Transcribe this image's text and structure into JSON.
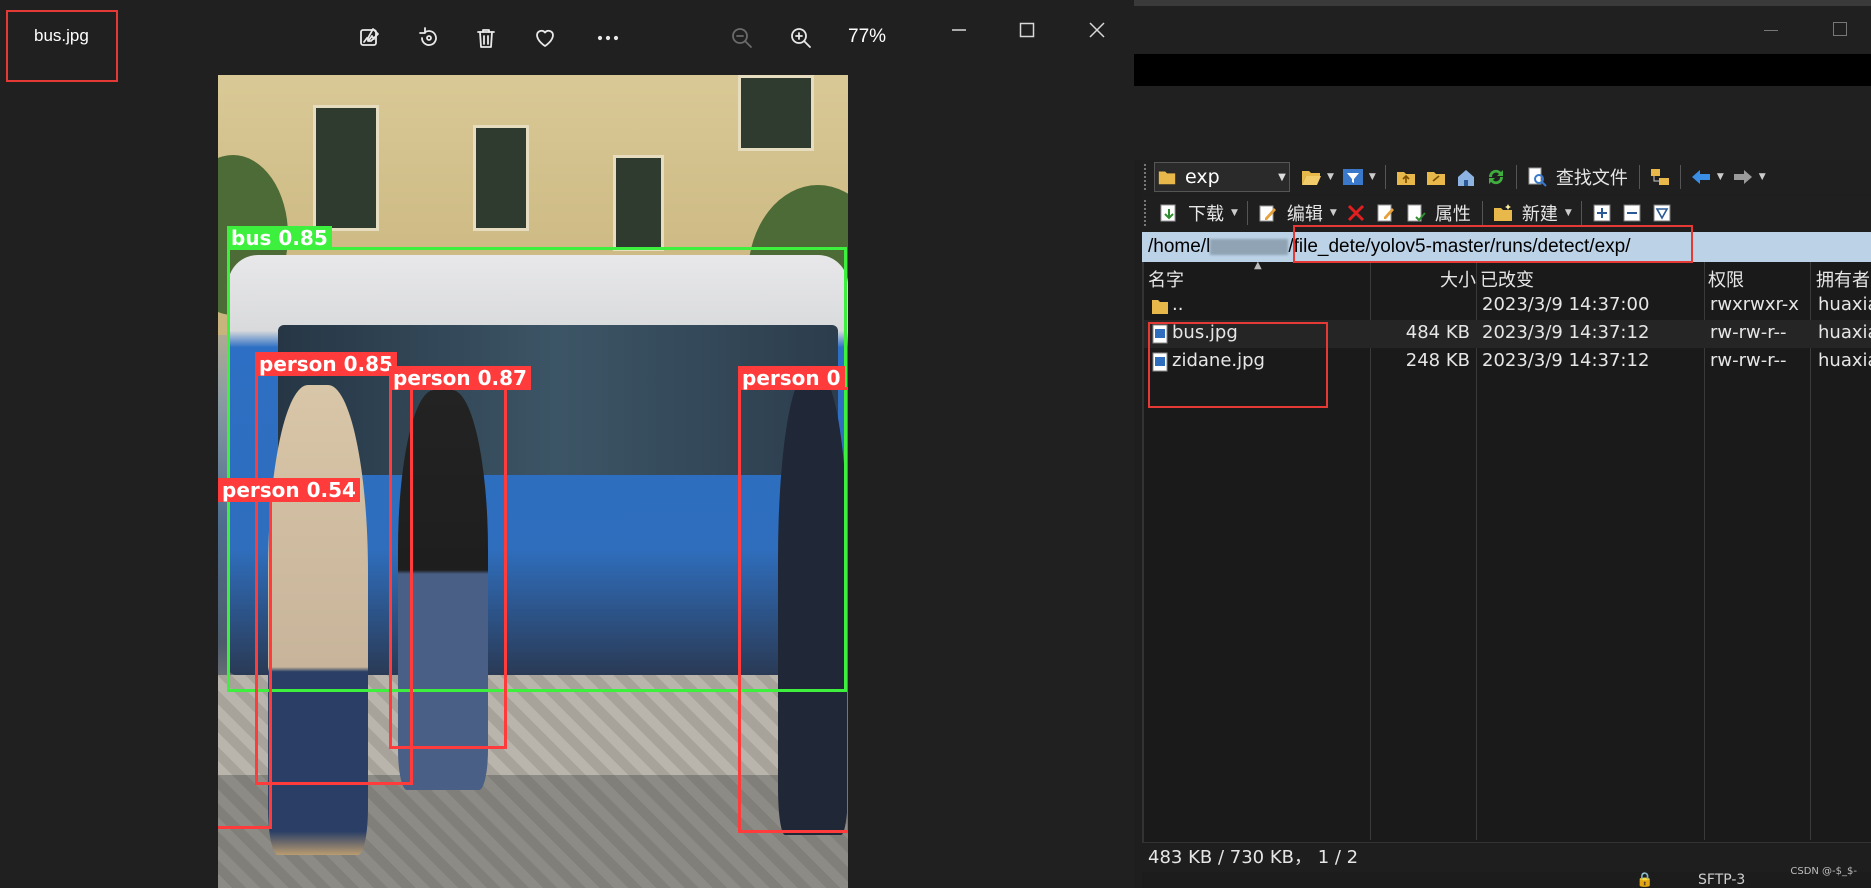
{
  "viewer": {
    "filename": "bus.jpg",
    "zoom": "77%",
    "toolbar": [
      "edit-image",
      "rotate",
      "delete",
      "favorite",
      "more",
      "zoom-out",
      "zoom-in"
    ],
    "detections": [
      {
        "label": "bus 0.85",
        "class": "bus"
      },
      {
        "label": "person 0.85",
        "class": "person"
      },
      {
        "label": "person 0.87",
        "class": "person"
      },
      {
        "label": "person 0",
        "class": "person"
      },
      {
        "label": "person 0.54",
        "class": "person"
      }
    ]
  },
  "fm": {
    "combo": "exp",
    "toolbar1": {
      "find_files": "查找文件"
    },
    "toolbar2": {
      "download": "下载",
      "edit": "编辑",
      "properties": "属性",
      "new": "新建"
    },
    "path": {
      "prefix": "/home/l",
      "suffix": "/file_dete/yolov5-master/runs/detect/exp/"
    },
    "columns": [
      "名字",
      "大小",
      "已改变",
      "权限",
      "拥有者"
    ],
    "rows": [
      {
        "name": "..",
        "size": "",
        "modified": "2023/3/9 14:37:00",
        "perm": "rwxrwxr-x",
        "owner": "huaxia"
      },
      {
        "name": "bus.jpg",
        "size": "484 KB",
        "modified": "2023/3/9 14:37:12",
        "perm": "rw-rw-r--",
        "owner": "huaxia"
      },
      {
        "name": "zidane.jpg",
        "size": "248 KB",
        "modified": "2023/3/9 14:37:12",
        "perm": "rw-rw-r--",
        "owner": "huaxia"
      }
    ],
    "status": "483 KB / 730 KB，  1 / 2",
    "status2": "SFTP-3",
    "watermark": "CSDN @-$_$-"
  },
  "colors": {
    "highlight": "#e53935",
    "bus_box": "#3df03d",
    "person_box": "#ff3b3b",
    "path_bg": "#bcd2e6"
  }
}
